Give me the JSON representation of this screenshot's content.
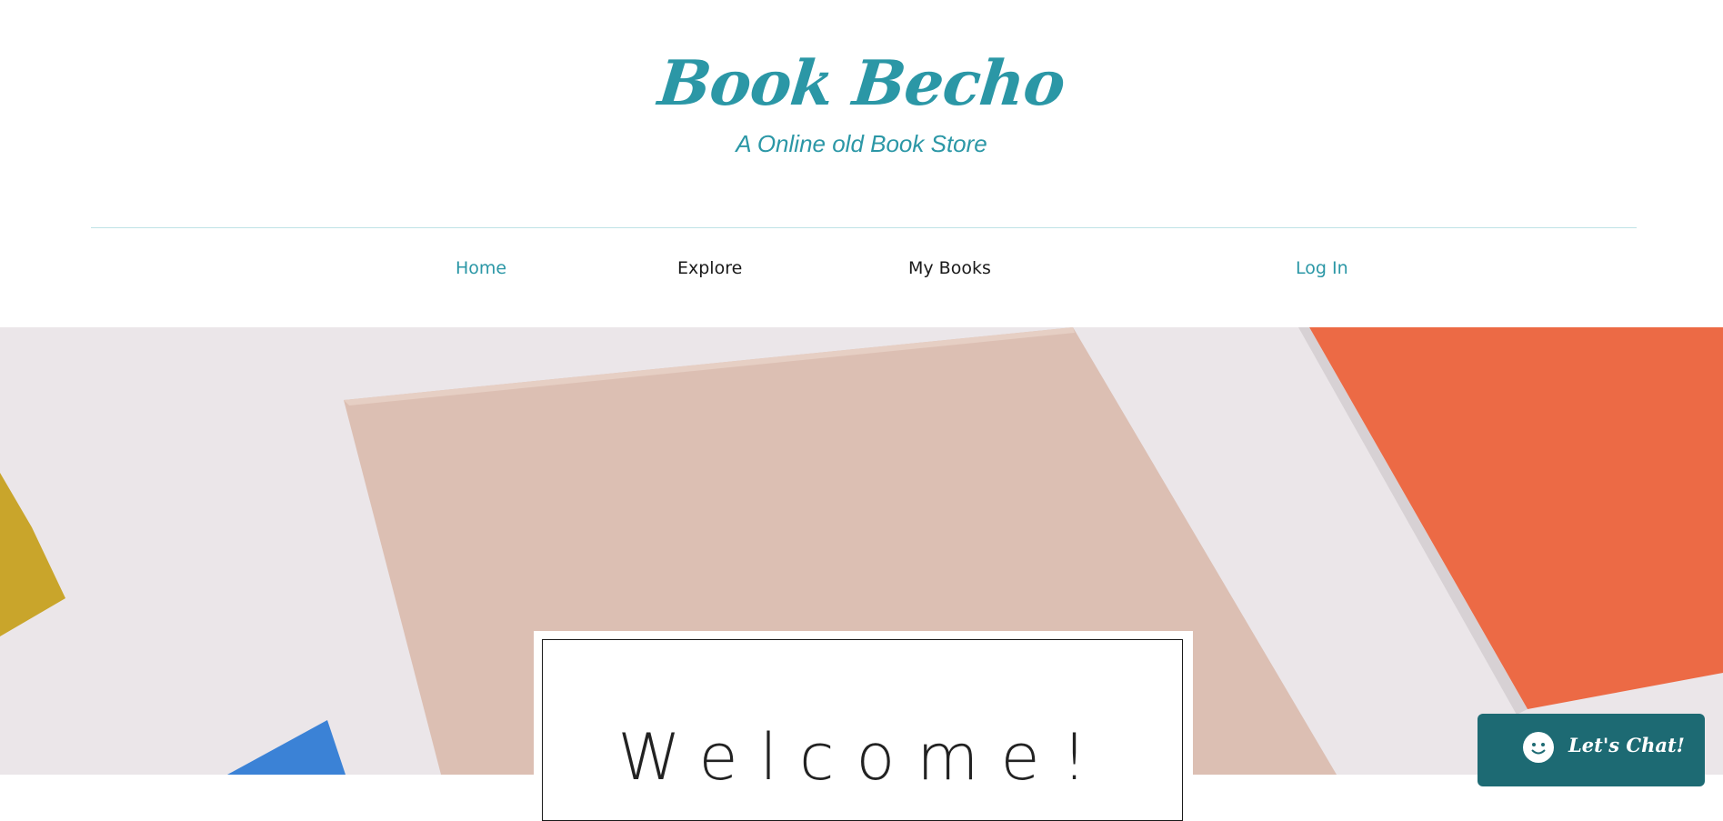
{
  "brand": {
    "title": "Book Becho",
    "tagline": "A Online old Book Store"
  },
  "nav": {
    "items": [
      {
        "label": "Home",
        "state": "active"
      },
      {
        "label": "Explore",
        "state": "default"
      },
      {
        "label": "My Books",
        "state": "default"
      },
      {
        "label": "Log In",
        "state": "default"
      }
    ]
  },
  "hero": {
    "welcome": "Welcome!"
  },
  "chat": {
    "label": "Let's Chat!",
    "icon": "smiley-chat-icon"
  },
  "colors": {
    "accent": "#2b97a6",
    "chat_bg": "#1d6a73",
    "hero_bg": "#ebe6e9",
    "pink_book": "#dcbfb3",
    "orange_book": "#ec6a45",
    "yellow_book": "#c9a52b",
    "blue_book": "#3b82d6"
  }
}
